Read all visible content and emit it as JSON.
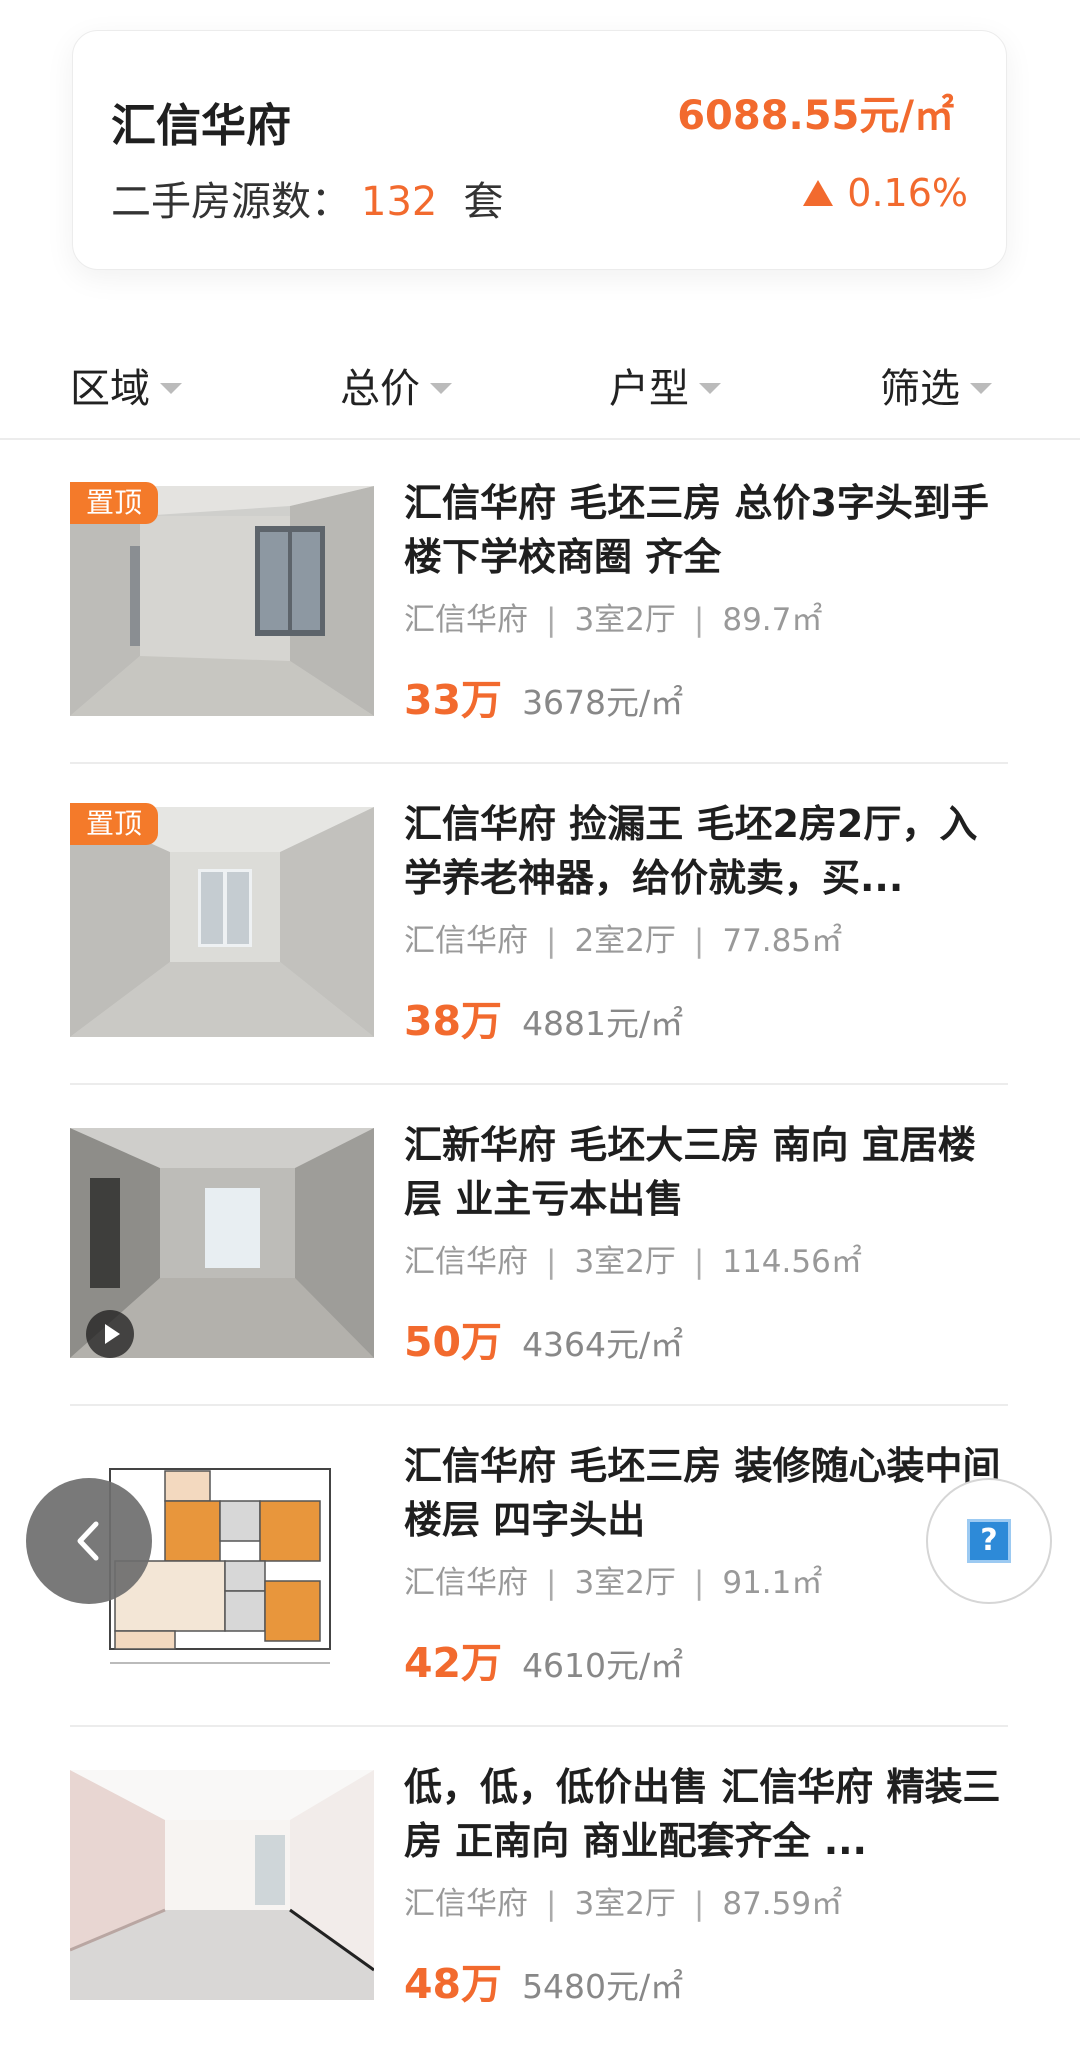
{
  "summary": {
    "community_name": "汇信华府",
    "avg_price": "6088.55元/㎡",
    "listing_count_label": "二手房源数：",
    "listing_count": "132",
    "listing_count_unit": "套",
    "price_change": "0.16%"
  },
  "filters": [
    {
      "label": "区域"
    },
    {
      "label": "总价"
    },
    {
      "label": "户型"
    },
    {
      "label": "筛选"
    }
  ],
  "listings": [
    {
      "badge": "置顶",
      "title": "汇信华府 毛坯三房 总价3字头到手 楼下学校商圈 齐全",
      "community": "汇信华府",
      "layout": "3室2厅",
      "area": "89.7㎡",
      "total_price": "33万",
      "unit_price": "3678元/㎡"
    },
    {
      "badge": "置顶",
      "title": "汇信华府 捡漏王 毛坯2房2厅，入学养老神器，给价就卖，买...",
      "community": "汇信华府",
      "layout": "2室2厅",
      "area": "77.85㎡",
      "total_price": "38万",
      "unit_price": "4881元/㎡"
    },
    {
      "title": "汇新华府 毛坯大三房 南向 宜居楼层 业主亏本出售",
      "community": "汇信华府",
      "layout": "3室2厅",
      "area": "114.56㎡",
      "total_price": "50万",
      "unit_price": "4364元/㎡"
    },
    {
      "title": "汇信华府 毛坯三房 装修随心装中间楼层 四字头出",
      "community": "汇信华府",
      "layout": "3室2厅",
      "area": "91.1㎡",
      "total_price": "42万",
      "unit_price": "4610元/㎡"
    },
    {
      "title": "低，低，低价出售 汇信华府 精装三房 正南向 商业配套齐全 ...",
      "community": "汇信华府",
      "layout": "3室2厅",
      "area": "87.59㎡",
      "total_price": "48万",
      "unit_price": "5480元/㎡"
    }
  ],
  "separator": "|",
  "floating": {
    "help_label": "?"
  },
  "colors": {
    "accent": "#f26a2e",
    "badge": "#f47a2a"
  }
}
